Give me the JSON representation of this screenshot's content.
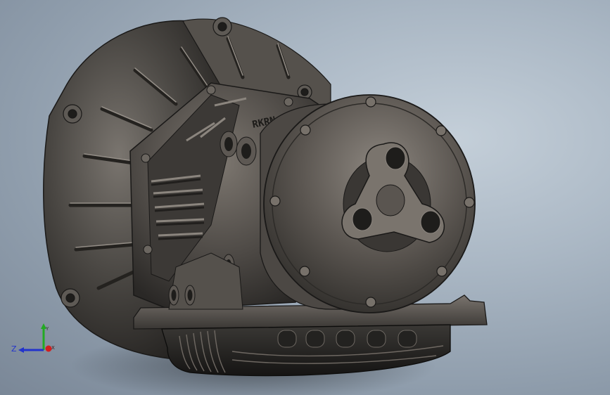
{
  "viewport": {
    "background_top": "#c4cfd9",
    "background_bottom": "#7a8797"
  },
  "model": {
    "body_color": "#4a4743",
    "highlight_color": "#8d8780",
    "shadow_color": "#1e1d1b",
    "engraving": "RKRN"
  },
  "triad": {
    "z_label": "Z",
    "y_label": "Y",
    "x_label": "X",
    "x_color": "#d21e1e",
    "y_color": "#22aa22",
    "z_color": "#2233cc"
  }
}
